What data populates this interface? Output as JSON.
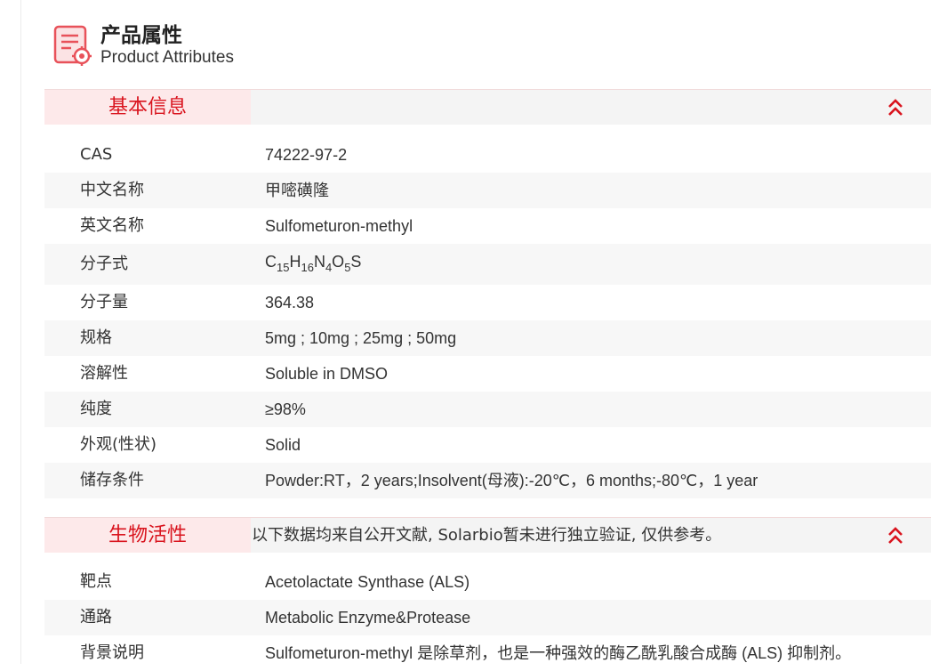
{
  "header": {
    "title_cn": "产品属性",
    "title_en": "Product Attributes",
    "icon": "product-attributes-icon",
    "accent": "#e8525a"
  },
  "colors": {
    "accent": "#d9141e",
    "tab_bg": "#fde9ea",
    "bar_bg": "#f4f4f4",
    "alt_row": "#f7f7f7"
  },
  "basic": {
    "title": "基本信息",
    "collapse_icon": "double-chevron-up-icon",
    "rows": [
      {
        "label": "CAS",
        "value": "74222-97-2"
      },
      {
        "label": "中文名称",
        "value": "甲嘧磺隆"
      },
      {
        "label": "英文名称",
        "value": "Sulfometuron-methyl"
      },
      {
        "label": "分子式",
        "value": "C15H16N4O5S",
        "formula": [
          [
            "C",
            "15"
          ],
          [
            "H",
            "16"
          ],
          [
            "N",
            "4"
          ],
          [
            "O",
            "5"
          ],
          [
            "S",
            ""
          ]
        ]
      },
      {
        "label": "分子量",
        "value": "364.38"
      },
      {
        "label": "规格",
        "value": "5mg ; 10mg ; 25mg ; 50mg"
      },
      {
        "label": "溶解性",
        "value": "Soluble in DMSO"
      },
      {
        "label": "纯度",
        "value": "≥98%"
      },
      {
        "label": "外观(性状)",
        "value": "Solid"
      },
      {
        "label": "储存条件",
        "value": "Powder:RT，2 years;Insolvent(母液):-20℃，6 months;-80℃，1 year"
      }
    ]
  },
  "bio": {
    "title": "生物活性",
    "note": "以下数据均来自公开文献, Solarbio暂未进行独立验证, 仅供参考。",
    "collapse_icon": "double-chevron-up-icon",
    "rows": [
      {
        "label": "靶点",
        "value": "Acetolactate Synthase (ALS)"
      },
      {
        "label": "通路",
        "value": "Metabolic Enzyme&Protease"
      },
      {
        "label": "背景说明",
        "value": "Sulfometuron-methyl 是除草剂，也是一种强效的酶乙酰乳酸合成酶 (ALS) 抑制剂。"
      }
    ]
  }
}
